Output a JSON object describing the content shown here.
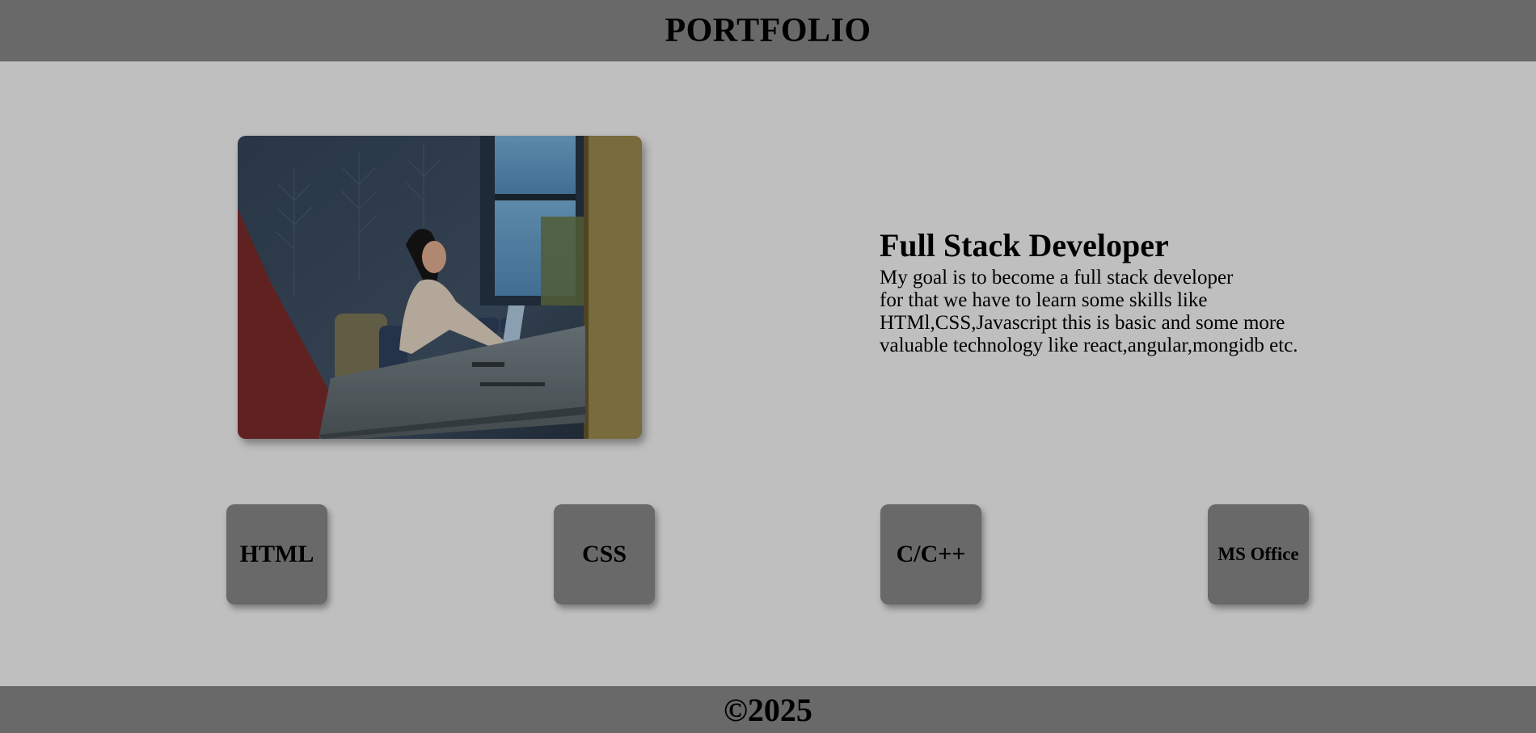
{
  "header": {
    "title": "PORTFOLIO"
  },
  "hero": {
    "photo_icon": "person-working-on-laptop-photo",
    "heading": "Full Stack Developer",
    "lines": [
      "My goal is to become a full stack developer",
      "for that we have to learn some skills like",
      "HTMl,CSS,Javascript this is basic and some more",
      "valuable technology like react,angular,mongidb etc."
    ]
  },
  "skills": [
    {
      "label": "HTML"
    },
    {
      "label": "CSS"
    },
    {
      "label": "C/C++"
    },
    {
      "label": "MS Office"
    }
  ],
  "footer": {
    "text": "©2025"
  },
  "colors": {
    "header_bg": "#696969",
    "page_bg": "#bfbfbf",
    "card_bg": "#696969",
    "text": "#000000"
  }
}
